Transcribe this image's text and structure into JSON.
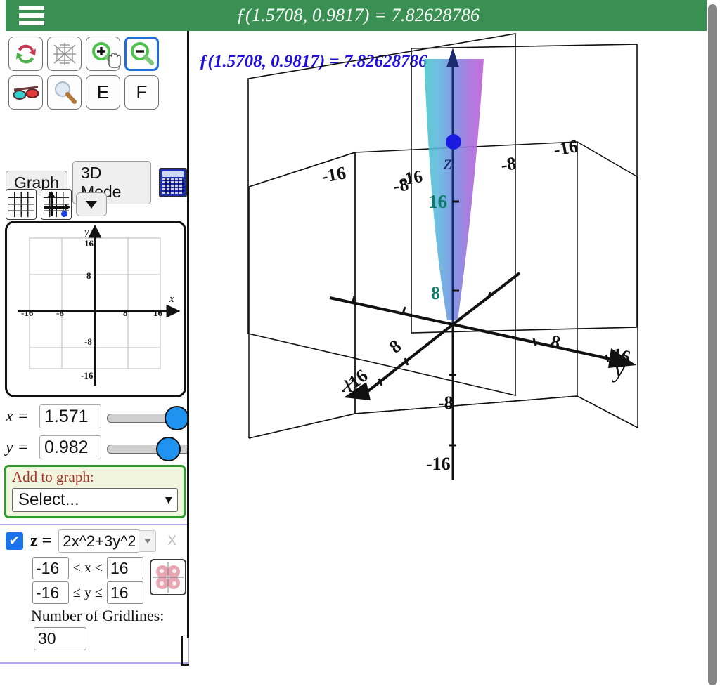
{
  "header": {
    "menu_icon": "hamburger-menu-icon",
    "title": "ƒ(1.5708, 0.9817) = 7.82628786"
  },
  "toolbar": {
    "row1": [
      {
        "name": "rotate-refresh-icon",
        "label": "",
        "selected": false
      },
      {
        "name": "axes-wireframe-icon",
        "label": "",
        "selected": false
      },
      {
        "name": "zoom-in-icon",
        "label": "",
        "selected": false
      },
      {
        "name": "zoom-out-icon",
        "label": "",
        "selected": true
      }
    ],
    "row2": [
      {
        "name": "anaglyph-glasses-icon",
        "label": "",
        "selected": false
      },
      {
        "name": "magnifier-icon",
        "label": "",
        "selected": false
      },
      {
        "name": "e-button",
        "label": "E",
        "selected": false
      },
      {
        "name": "f-button",
        "label": "F",
        "selected": false
      }
    ]
  },
  "modes": {
    "graph_label": "Graph",
    "mode_label": "3D Mode",
    "calculator_icon": "calculator-icon",
    "grid_icon": "grid-icon",
    "grid_axes_icon": "grid-axes-point-icon",
    "dropdown_icon": "chevron-down-icon"
  },
  "preview": {
    "x_axis_label": "x",
    "y_axis_label": "y",
    "x_ticks": [
      "-16",
      "-8",
      "8",
      "16"
    ],
    "y_ticks": [
      "16",
      "8",
      "-8",
      "-16"
    ]
  },
  "variables": {
    "x_label": "x =",
    "x_value": "1.571",
    "y_label": "y =",
    "y_value": "0.982"
  },
  "add_to_graph": {
    "label": "Add to graph:",
    "selected": "Select...",
    "chevron": "⌄"
  },
  "function_entry": {
    "enabled": true,
    "check_glyph": "✔",
    "z_label": "z =",
    "expression": "2x^2+3y^2",
    "remove_label": "X",
    "x_min": "-16",
    "x_max": "16",
    "y_min": "-16",
    "y_max": "16",
    "x_constraint": "≤ x ≤",
    "y_constraint": "≤ y ≤",
    "gridlines_label": "Number of Gridlines:",
    "gridlines_value": "30",
    "settings_icon": "gear-icon",
    "color_swatch_icon": "color-swatch-icon"
  },
  "plot": {
    "equation": "ƒ(1.5708, 0.9817) = 7.82628786",
    "axes": {
      "x_label": "x",
      "y_label": "y",
      "z_label": "z",
      "x_ticks": [
        "8",
        "16"
      ],
      "x_neg_ticks": [
        "-8",
        "-16"
      ],
      "y_ticks": [
        "8",
        "16"
      ],
      "y_neg_ticks": [
        "-8",
        "-16"
      ],
      "z_ticks": [
        "8",
        "16"
      ],
      "z_neg_ticks": [
        "-8",
        "-16"
      ]
    },
    "point": {
      "color": "#1a1ae0"
    },
    "surface": {
      "color_left": "#4cc8c8",
      "color_right": "#b45ae0"
    }
  },
  "colors": {
    "header_green": "#3a9053",
    "accent_blue": "#1f93ef",
    "equation_blue": "#2010e0",
    "add_box_border": "#2e9b2e",
    "add_box_bg": "#f2f5dd",
    "add_box_text": "#a13129",
    "fn_block_border": "#b0a8f0"
  },
  "scrollbar": {
    "name": "vertical-scrollbar"
  }
}
